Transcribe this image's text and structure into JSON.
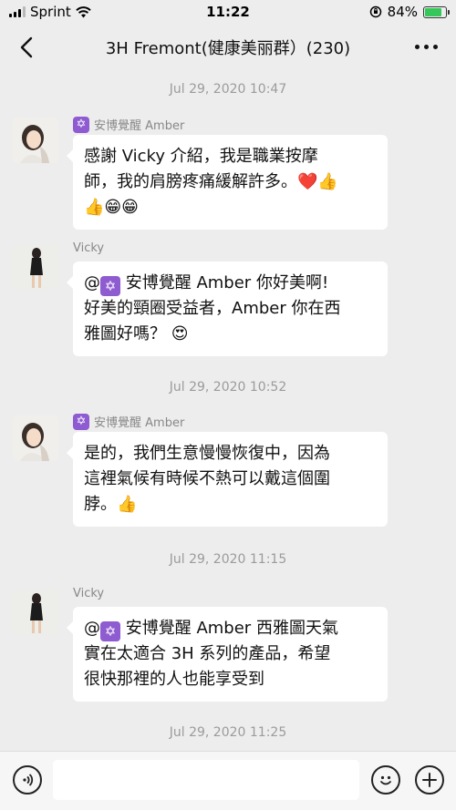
{
  "status_bar": {
    "carrier": "Sprint",
    "time": "11:22",
    "battery": "84%",
    "battery_level": 0.84
  },
  "nav": {
    "title": "3H  Fremont(健康美丽群）(230)",
    "back_icon": "chevron-left-icon",
    "more_icon": "more-dots-icon"
  },
  "messages": [
    {
      "type": "timestamp",
      "text": "Jul 29, 2020 10:47"
    },
    {
      "type": "message",
      "sender": "安博覺醒 Amber",
      "lines": [
        "感謝 Vicky 介紹，我是職業按摩",
        "師，我的肩膀疼痛緩解許多。❤️👍",
        "👍😁😁"
      ]
    },
    {
      "type": "message",
      "sender": "Vicky",
      "mention_name": "安博覺醒 Amber",
      "lines_after_mention": "你好美啊!",
      "lines": [
        "好美的頸圈受益者，Amber 你在西",
        "雅圖好嗎？ 😍"
      ]
    },
    {
      "type": "timestamp",
      "text": "Jul 29, 2020 10:52"
    },
    {
      "type": "message",
      "sender": "安博覺醒 Amber",
      "lines": [
        "是的，我們生意慢慢恢復中，因為",
        "這裡氣候有時候不熱可以戴這個圍",
        "脖。👍"
      ]
    },
    {
      "type": "timestamp",
      "text": "Jul 29, 2020 11:15"
    },
    {
      "type": "message",
      "sender": "Vicky",
      "mention_name": "安博覺醒 Amber",
      "lines_after_mention": "西雅圖天氣",
      "lines": [
        "實在太適合 3H 系列的產品，希望",
        "很快那裡的人也能享受到"
      ]
    },
    {
      "type": "timestamp",
      "text": "Jul 29, 2020 11:25"
    }
  ],
  "colors": {
    "background": "#ededed",
    "bubble": "#ffffff",
    "badge_purple": "#8e5bd0",
    "battery_green": "#35c759"
  }
}
